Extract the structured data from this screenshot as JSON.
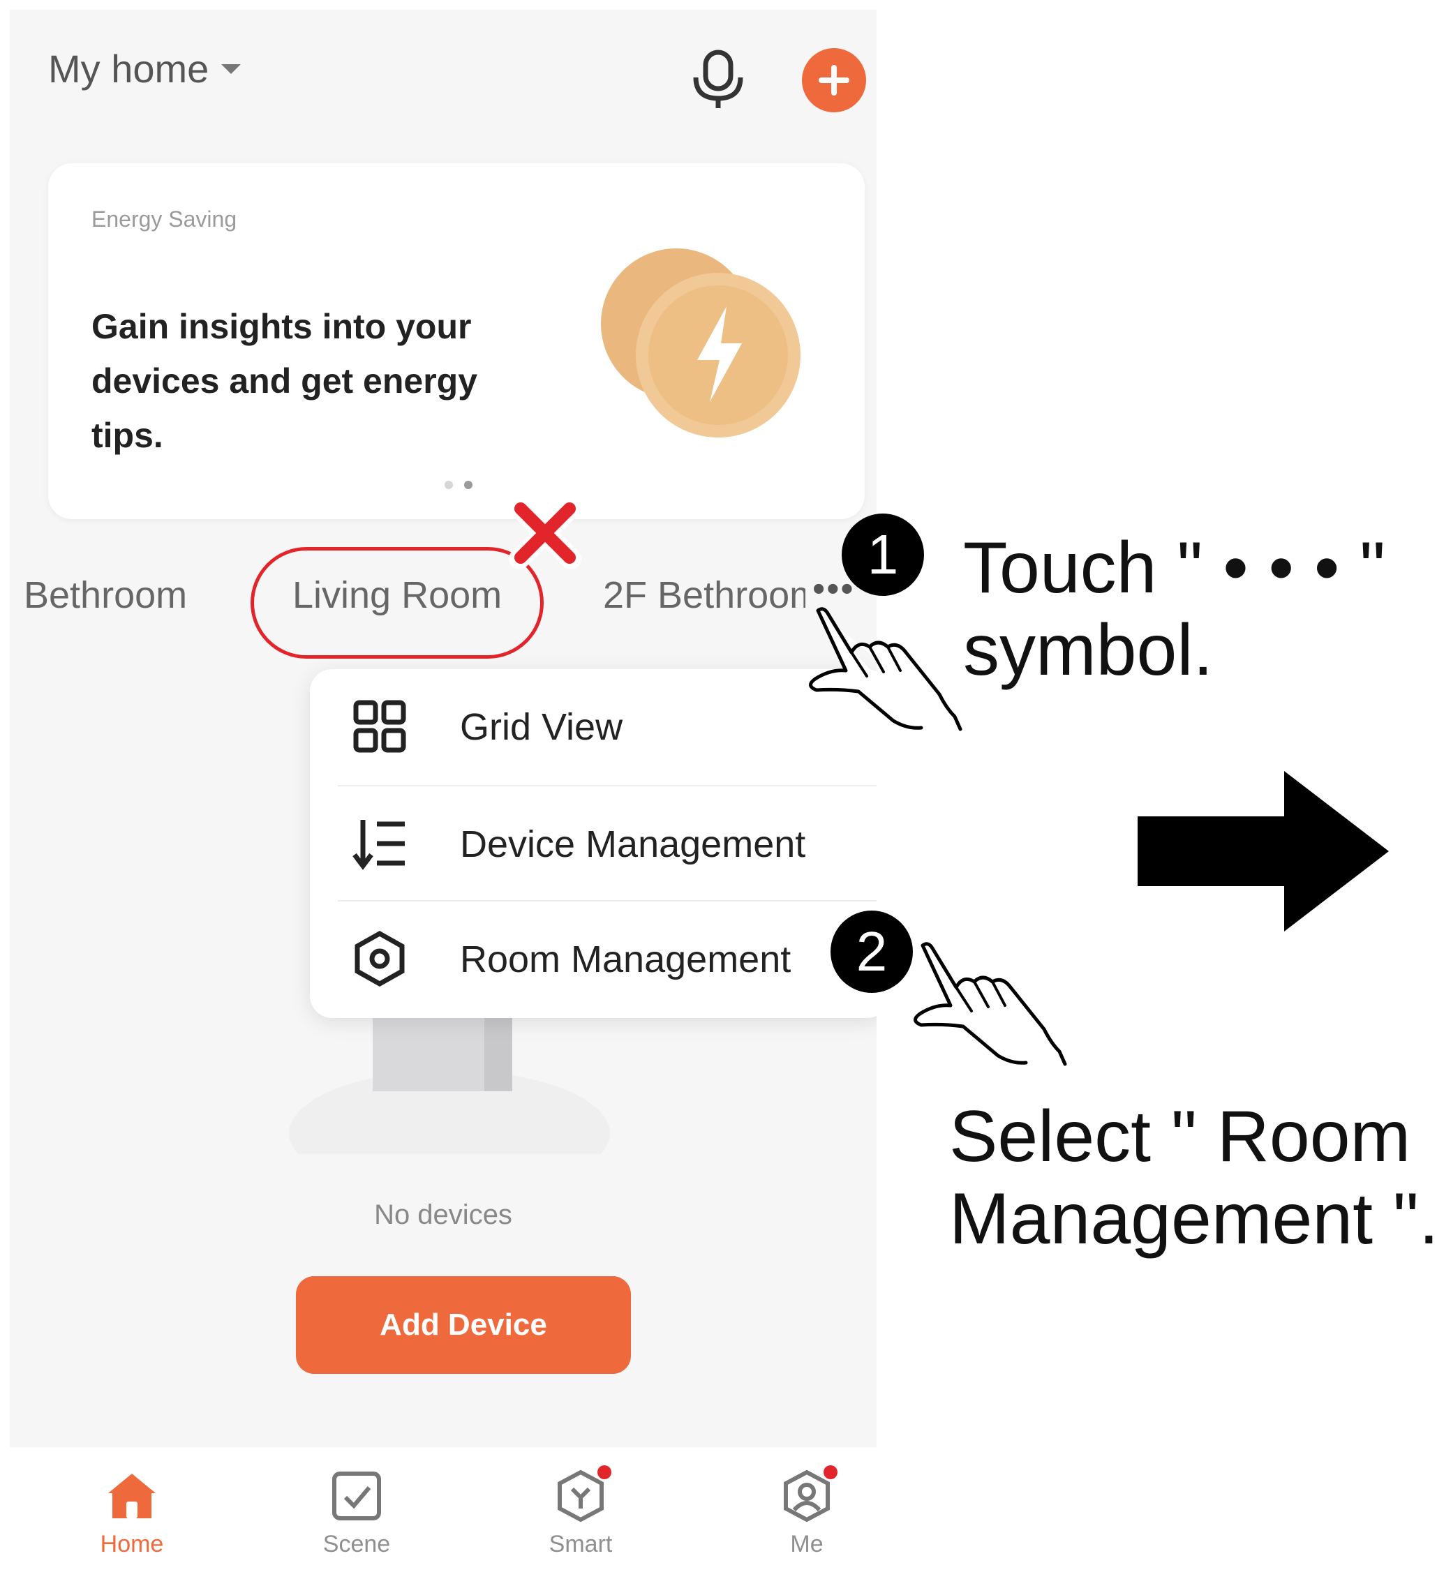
{
  "header": {
    "home_title": "My home",
    "mic_icon": "microphone-icon",
    "add_icon": "plus-icon"
  },
  "banner": {
    "tag": "Energy Saving",
    "text": "Gain insights into your devices and get energy tips.",
    "pagination": {
      "count": 2,
      "active": 2
    }
  },
  "rooms": {
    "tabs": [
      "Bethroom",
      "Living Room",
      "2F Bethroom"
    ],
    "more": "•••"
  },
  "menu": {
    "items": [
      {
        "label": "Grid View",
        "icon": "grid-view-icon"
      },
      {
        "label": "Device Management",
        "icon": "sort-list-icon"
      },
      {
        "label": "Room Management",
        "icon": "hexagon-settings-icon"
      }
    ]
  },
  "empty": {
    "message": "No devices",
    "add_button": "Add Device"
  },
  "tabbar": {
    "items": [
      {
        "label": "Home",
        "icon": "home-icon",
        "active": true
      },
      {
        "label": "Scene",
        "icon": "scene-icon",
        "active": false
      },
      {
        "label": "Smart",
        "icon": "smart-icon",
        "active": false,
        "badge": true
      },
      {
        "label": "Me",
        "icon": "profile-icon",
        "active": false,
        "badge": true
      }
    ]
  },
  "annotations": {
    "step1": {
      "number": "1",
      "line1": "Touch \" • • • \"",
      "line2": "symbol."
    },
    "step2": {
      "number": "2",
      "line1": "Select \" Room",
      "line2": "Management \"."
    }
  },
  "colors": {
    "accent": "#ee6a3c",
    "highlight_red": "#e2252b",
    "background": "#f6f6f7"
  }
}
